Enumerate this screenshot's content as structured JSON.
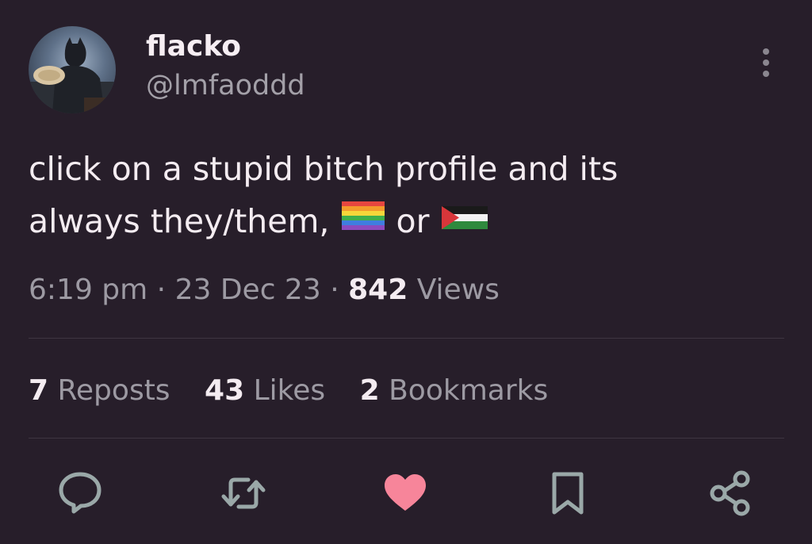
{
  "author": {
    "name": "flacko",
    "handle": "@lmfaoddd"
  },
  "tweet": {
    "line1": "click on a stupid bitch profile and its",
    "line2_prefix": "always they/them,",
    "line2_middle": "or",
    "flag1": "rainbow-flag-emoji",
    "flag2": "palestine-flag-emoji"
  },
  "meta": {
    "time": "6:19 pm",
    "separator": "·",
    "date": "23 Dec 23",
    "views_count": "842",
    "views_label": "Views"
  },
  "stats": {
    "reposts_count": "7",
    "reposts_label": "Reposts",
    "likes_count": "43",
    "likes_label": "Likes",
    "bookmarks_count": "2",
    "bookmarks_label": "Bookmarks"
  },
  "actions": [
    "reply-icon",
    "repost-icon",
    "like-icon",
    "bookmark-icon",
    "share-icon"
  ],
  "colors": {
    "background": "#271e2a",
    "like_active": "#f7859a",
    "icon": "#9aa8a8"
  }
}
